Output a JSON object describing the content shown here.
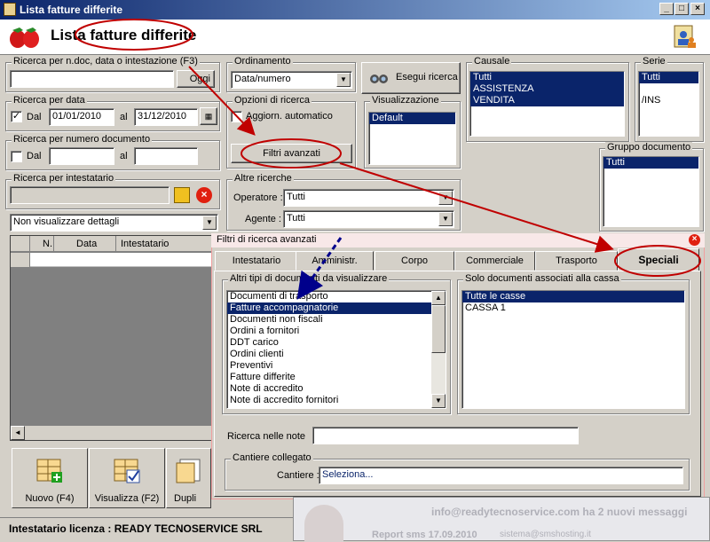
{
  "window": {
    "title": "Lista fatture differite",
    "header_title": "Lista fatture differite"
  },
  "search_ndoc": {
    "legend": "Ricerca per n.doc, data o intestazione (F3)",
    "value": "",
    "button": "Oggi"
  },
  "search_date": {
    "legend": "Ricerca per data",
    "dal_label": "Dal",
    "dal_checked": "✓",
    "dal_value": "01/01/2010",
    "al_label": "al",
    "al_value": "31/12/2010"
  },
  "search_num": {
    "legend": "Ricerca per numero documento",
    "dal_label": "Dal",
    "dal_value": "",
    "al_label": "al",
    "al_value": ""
  },
  "search_intestatario": {
    "legend": "Ricerca per intestatario",
    "value": ""
  },
  "details_select": "Non visualizzare dettagli",
  "table": {
    "columns": [
      "N.",
      "Data",
      "Intestatario"
    ]
  },
  "ordinamento": {
    "legend": "Ordinamento",
    "value": "Data/numero"
  },
  "esegui_button": "Esegui ricerca",
  "opzioni": {
    "legend": "Opzioni di ricerca",
    "aggiorn_label": "Aggiorn. automatico"
  },
  "filtri_button": "Filtri avanzati",
  "visualizzazione": {
    "legend": "Visualizzazione",
    "items": [
      "Default"
    ]
  },
  "altre": {
    "legend": "Altre ricerche",
    "operatore_label": "Operatore :",
    "operatore_value": "Tutti",
    "agente_label": "Agente :",
    "agente_value": "Tutti"
  },
  "causale": {
    "legend": "Causale",
    "items": [
      "Tutti",
      "ASSISTENZA",
      "VENDITA"
    ]
  },
  "serie": {
    "legend": "Serie",
    "items": [
      "Tutti",
      "",
      "/INS"
    ]
  },
  "gruppo": {
    "legend": "Gruppo documento",
    "items": [
      "Tutti"
    ]
  },
  "panel": {
    "title": "Filtri di ricerca avanzati",
    "tabs": [
      "Intestatario",
      "Amministr.",
      "Corpo",
      "Commerciale",
      "Trasporto",
      "Speciali"
    ],
    "altri_legend": "Altri tipi di documenti da visualizzare",
    "doc_types": [
      "Documenti di trasporto",
      "Fatture accompagnatorie",
      "Documenti non fiscali",
      "Ordini a fornitori",
      "DDT carico",
      "Ordini clienti",
      "Preventivi",
      "Fatture differite",
      "Note di accredito",
      "Note di accredito fornitori"
    ],
    "solo_legend": "Solo documenti associati alla cassa",
    "casse": [
      "Tutte le casse",
      "CASSA 1"
    ],
    "note_label": "Ricerca nelle note",
    "note_value": "",
    "cantiere_legend": "Cantiere collegato",
    "cantiere_label": "Cantiere :",
    "cantiere_value": "Seleziona..."
  },
  "bottom_buttons": {
    "nuovo": "Nuovo (F4)",
    "visualizza": "Visualizza (F2)",
    "duplica": "Dupli"
  },
  "status": {
    "licenza": "Intestatario licenza : READY TECNOSERVICE SRL"
  },
  "notification": {
    "line1": "info@readytecnoservice.com ha 2 nuovi messaggi",
    "line2a": "Report sms 17.09.2010",
    "line2b": "sistema@smshosting.it"
  },
  "colors": {
    "selection": "#0a246a",
    "annotation_red": "#c00000",
    "annotation_blue": "#00008b"
  }
}
